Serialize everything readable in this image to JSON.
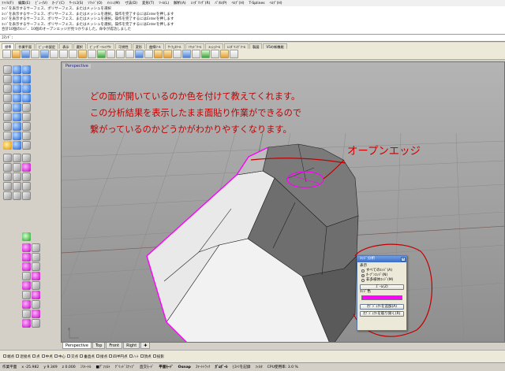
{
  "menubar": {
    "items": [
      "ﾌｧｲﾙ(F)",
      "編集(E)",
      "ﾋﾞｭｰ(V)",
      "ｶｰﾌﾞ(C)",
      "ｻｰﾌｪｽ(S)",
      "ｿﾘｯﾄﾞ(O)",
      "ﾒｯｼｭ(M)",
      "寸法(D)",
      "変形(T)",
      "ﾂｰﾙ(L)",
      "解析(A)",
      "ﾚﾝﾀﾞﾘﾝｸﾞ(R)",
      "ﾊﾟﾈﾙ(P)",
      "ﾍﾙﾌﾟ(H)",
      "T-Splines",
      "ﾍﾙﾌﾟ(H)"
    ]
  },
  "command_history": [
    "ｴｯｼﾞを表示するサーフェス、ポリサーフェス、またはメッシュを選択",
    "ｴｯｼﾞを表示するサーフェス、ポリサーフェス、またはメッシュを選択。操作を完了するにはEnterを押します",
    "ｴｯｼﾞを表示するサーフェス、ポリサーフェス、またはメッシュを選択。操作を完了するにはEnterを押します",
    "ｴｯｼﾞを表示するサーフェス、ポリサーフェス、またはメッシュを選択。操作を完了するにはEnterを押します",
    "合計10個のｴｯｼﾞ、10個のオープンエッジが見つかりました。命令が成功しました"
  ],
  "command_prompt": "ｺﾏﾝﾄﾞ:",
  "toolbar_tabs": [
    "標準",
    "作業平面",
    "ﾋﾞｭｰの設定",
    "表示",
    "選択",
    "ﾋﾞｭｰﾎﾟｰﾄﾚｲｱｳﾄ",
    "可視性",
    "変形",
    "曲線ﾂｰﾙ",
    "ｻｰﾌｪｽﾂｰﾙ",
    "ｿﾘｯﾄﾞﾂｰﾙ",
    "ﾒｯｼｭﾂｰﾙ",
    "ﾚﾝﾀﾞﾘﾝｸﾞﾂｰﾙ",
    "製図",
    "V5の新機能"
  ],
  "viewport": {
    "title": "Perspective",
    "annotation_lines": [
      "どの面が開いているのか色を付けて教えてくれます。",
      "この分析結果を表示したまま面貼り作業ができるので",
      "繋がっているのかどうかがわかりやすくなります。"
    ],
    "open_edge_label": "オープンエッジ"
  },
  "view_tabs": [
    "Perspective",
    "Top",
    "Front",
    "Right"
  ],
  "edge_dialog": {
    "title": "ｴｯｼﾞ分析",
    "display_label": "表示",
    "options": [
      "すべてのｴｯｼﾞ(A)",
      "ｵｰﾌﾟﾝｴｯｼﾞ(N)",
      "非多様体ｴｯｼﾞ(M)"
    ],
    "selected_option": 1,
    "zoom_button": "ｽﾞｰﾑ(Z)",
    "edge_color_label": "ｴｯｼﾞ色",
    "edge_color": "#ff00ff",
    "add_objects_button": "ｵﾌﾞｼﾞｪｸﾄを追加(A)",
    "remove_objects_button": "ｵﾌﾞｼﾞｪｸﾄを取り除く(R)"
  },
  "osnap": [
    "端点",
    "近接点",
    "点",
    "中点",
    "中心",
    "交点",
    "垂直点",
    "接点",
    "四半円点",
    "ﾉｯﾄ",
    "頂点",
    "投影"
  ],
  "statusbar": {
    "cplane": "作業平面",
    "x": "x -25.982",
    "y": "y 9.349",
    "z": "z 0.000",
    "units": "ﾐﾘﾒｰﾄﾙ",
    "layer": "■ﾃﾞﾌｫﾙﾄ",
    "grid_snap": "ｸﾞﾘｯﾄﾞｽﾅｯﾌﾟ",
    "ortho": "直交ﾓｰﾄﾞ",
    "planar": "平面ﾓｰﾄﾞ",
    "osnap": "Osnap",
    "smarttrack": "ｽﾏｰﾄﾄﾗｯｸ",
    "gumball": "ｶﾞﾑﾎﾞｰﾙ",
    "history": "ﾋｽﾄﾘを記録",
    "filter": "ﾌｨﾙﾀ",
    "cpu": "CPU使用率: 3.0 %"
  },
  "colors": {
    "annotation_red": "#c00000",
    "open_edge_magenta": "#ff00ff",
    "viewport_bg": "#a0a0a0"
  }
}
